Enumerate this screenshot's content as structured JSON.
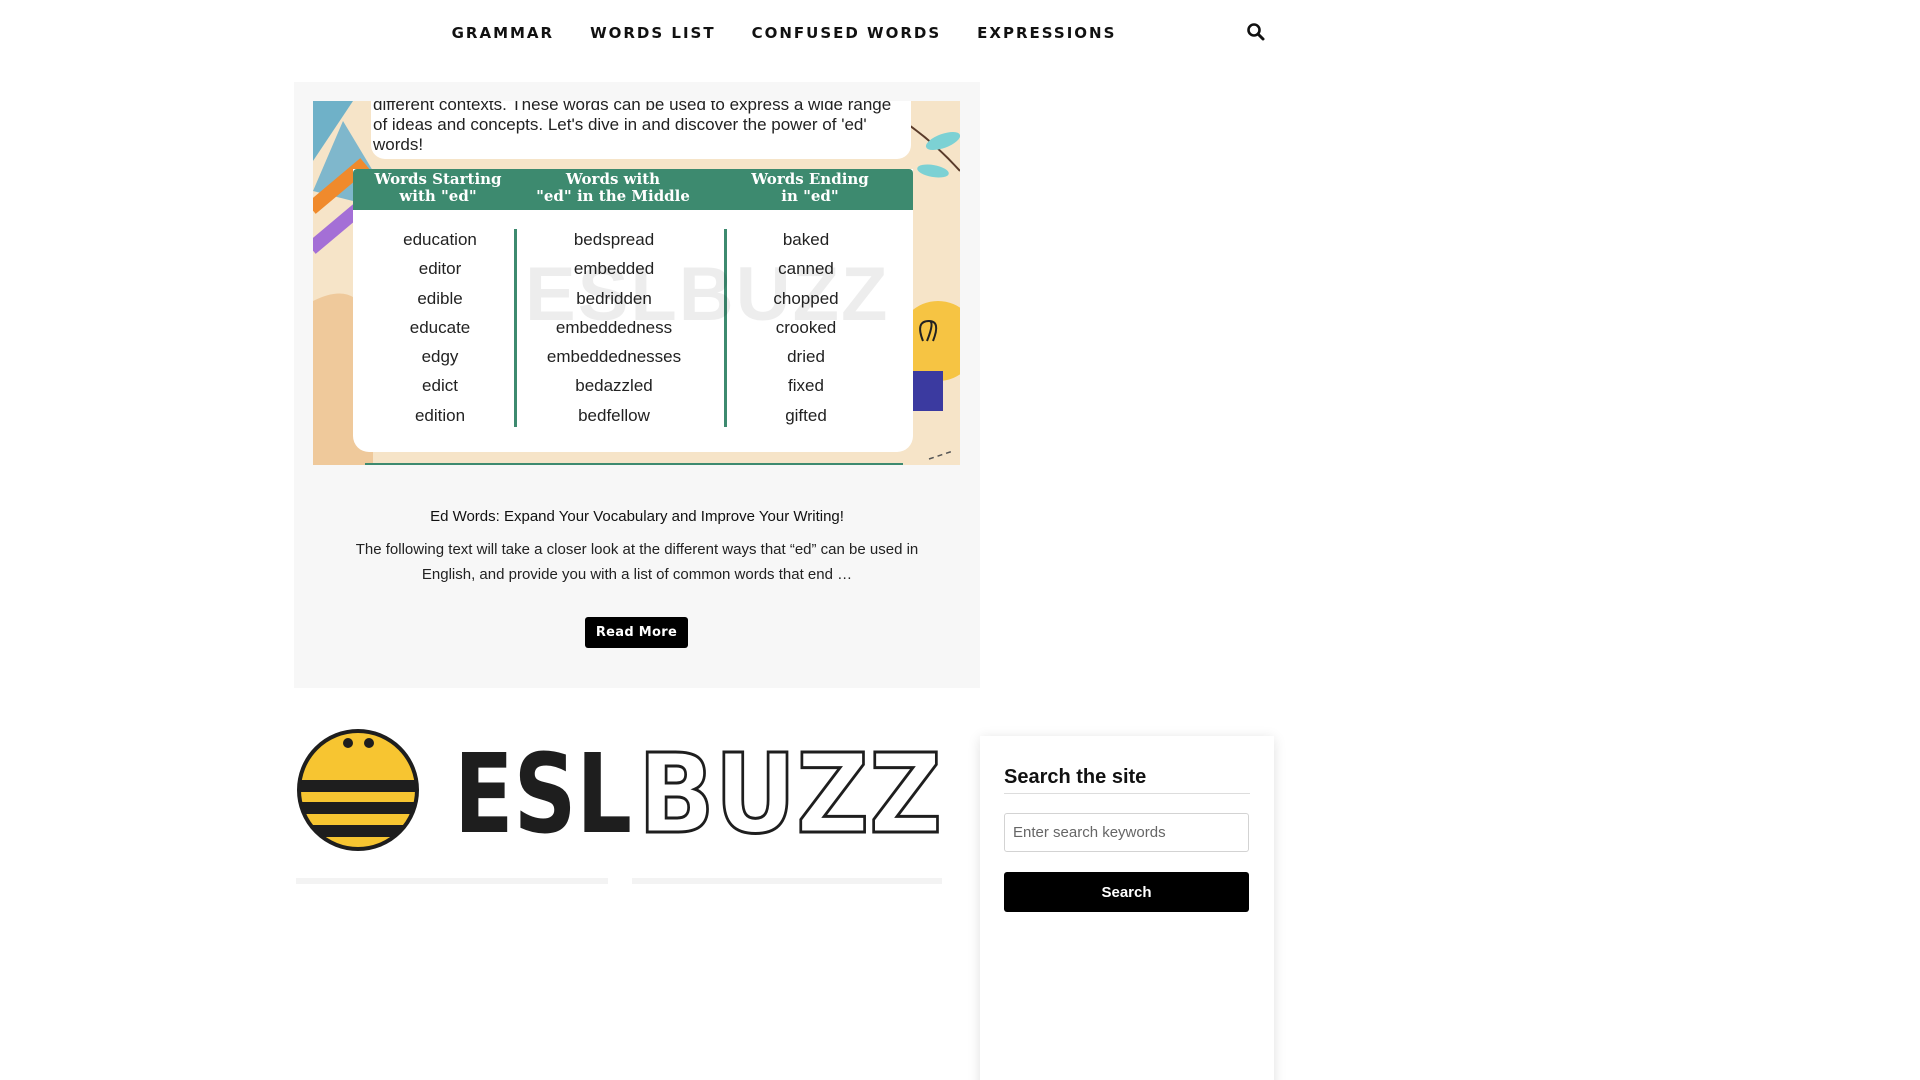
{
  "nav": {
    "items": [
      "GRAMMAR",
      "WORDS LIST",
      "CONFUSED WORDS",
      "EXPRESSIONS"
    ],
    "search_icon": "search-icon"
  },
  "post": {
    "image": {
      "intro_lines": [
        "different contexts. These words can be used to express a wide range",
        "of ideas and concepts. Let's dive in and discover the power of 'ed'",
        "words!"
      ],
      "columns": [
        {
          "heading": [
            "Words Starting",
            "with \"ed\""
          ],
          "words": [
            "education",
            "editor",
            "edible",
            "educate",
            "edgy",
            "edict",
            "edition"
          ]
        },
        {
          "heading": [
            "Words with",
            "\"ed\" in the Middle"
          ],
          "words": [
            "bedspread",
            "embedded",
            "bedridden",
            "embeddedness",
            "embeddednesses",
            "bedazzled",
            "bedfellow"
          ]
        },
        {
          "heading": [
            "Words Ending",
            "in \"ed\""
          ],
          "words": [
            "baked",
            "canned",
            "chopped",
            "crooked",
            "dried",
            "fixed",
            "gifted"
          ]
        }
      ],
      "watermark": "ESLBUZZ"
    },
    "title": "Ed Words: Expand Your Vocabulary and Improve Your Writing!",
    "excerpt": "The following text will take a closer look at the different ways that “ed” can be used in English, and provide you with a list of common words that end …",
    "read_more": "Read More"
  },
  "logo": {
    "text_bold": "ESL",
    "text_outline": "BUZZ",
    "colors": {
      "yellow": "#F7C531",
      "black": "#1e1e1e"
    }
  },
  "sidebar": {
    "widget_title": "Search the site",
    "search_placeholder": "Enter search keywords",
    "search_button": "Search"
  },
  "colors": {
    "table_green": "#3d8a6f",
    "card_bg": "#f7f7f7",
    "button_bg": "#000000"
  }
}
